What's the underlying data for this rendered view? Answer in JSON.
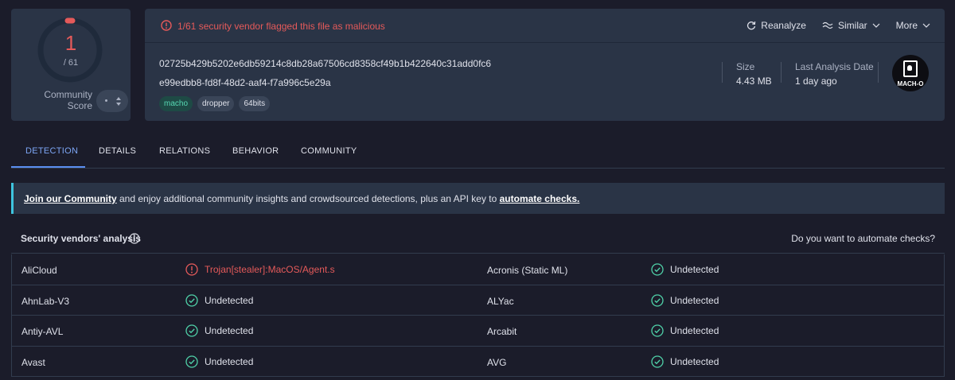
{
  "score": {
    "detections": "1",
    "total": "/ 61",
    "community_label": "Community Score"
  },
  "alert": {
    "text": "1/61 security vendor flagged this file as malicious"
  },
  "actions": {
    "reanalyze": "Reanalyze",
    "similar": "Similar",
    "more": "More"
  },
  "file": {
    "hash": "02725b429b5202e6db59214c8db28a67506cd8358cf49b1b422640c31add0fc6",
    "uuid": "e99edbb8-fd8f-48d2-aaf4-f7a996c5e29a",
    "tags": [
      "macho",
      "dropper",
      "64bits"
    ],
    "size_label": "Size",
    "size_value": "4.43 MB",
    "date_label": "Last Analysis Date",
    "date_value": "1 day ago",
    "type_label": "MACH-O"
  },
  "tabs": [
    "DETECTION",
    "DETAILS",
    "RELATIONS",
    "BEHAVIOR",
    "COMMUNITY"
  ],
  "banner": {
    "link1": "Join our Community",
    "middle": " and enjoy additional community insights and crowdsourced detections, plus an API key to ",
    "link2": "automate checks."
  },
  "analysis": {
    "title": "Security vendors' analysis",
    "automate": "Do you want to automate checks?"
  },
  "vendors": [
    {
      "left_name": "AliCloud",
      "left_result": "Trojan[stealer]:MacOS/Agent.s",
      "left_malicious": true,
      "right_name": "Acronis (Static ML)",
      "right_result": "Undetected",
      "right_malicious": false
    },
    {
      "left_name": "AhnLab-V3",
      "left_result": "Undetected",
      "left_malicious": false,
      "right_name": "ALYac",
      "right_result": "Undetected",
      "right_malicious": false
    },
    {
      "left_name": "Antiy-AVL",
      "left_result": "Undetected",
      "left_malicious": false,
      "right_name": "Arcabit",
      "right_result": "Undetected",
      "right_malicious": false
    },
    {
      "left_name": "Avast",
      "left_result": "Undetected",
      "left_malicious": false,
      "right_name": "AVG",
      "right_result": "Undetected",
      "right_malicious": false
    }
  ],
  "colors": {
    "malicious": "#e55a5a",
    "clean": "#4fd1a8",
    "accent": "#7da6f5",
    "banner_border": "#3ec4de"
  }
}
